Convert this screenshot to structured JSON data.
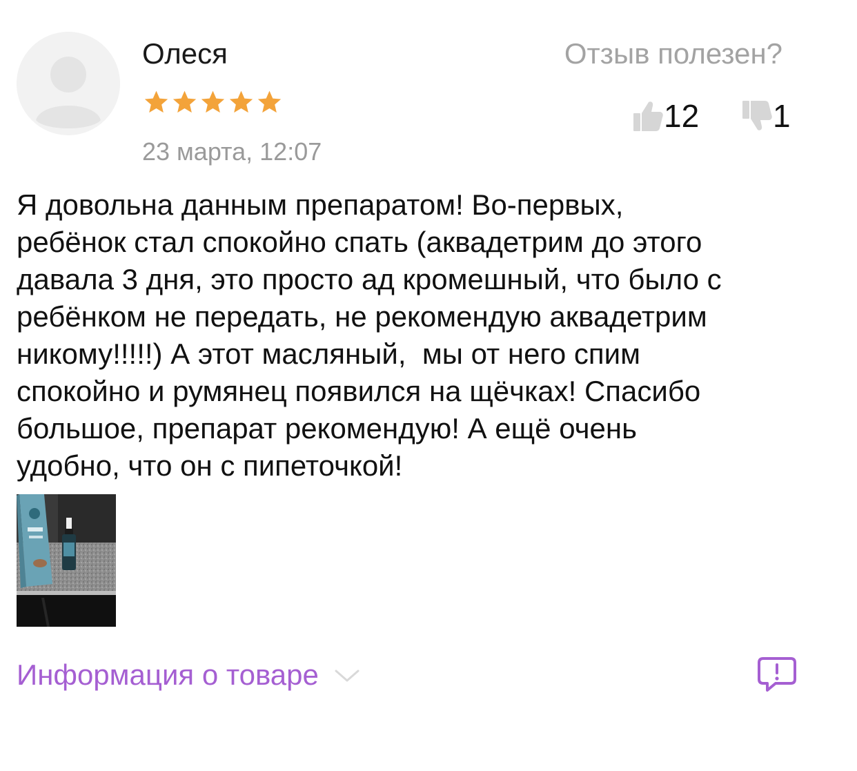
{
  "review": {
    "author": "Олеся",
    "rating": 5,
    "rating_max": 5,
    "date": "23 марта, 12:07",
    "text": "Я довольна данным препаратом! Во-первых,\nребёнок стал спокойно спать (аквадетрим до этого\nдавала 3 дня, это просто ад кромешный, что было с\nребёнком не передать, не рекомендую аквадетрим\nникому!!!!!) А этот масляный,  мы от него спим\nспокойно и румянец появился на щёчках! Спасибо\nбольшое, препарат рекомендую! А ещё очень\nудобно, что он с пипеточкой!",
    "photos_count": 1
  },
  "helpfulness": {
    "question": "Отзыв полезен?",
    "likes": "12",
    "dislikes": "1"
  },
  "footer": {
    "product_info_label": "Информация о товаре"
  },
  "colors": {
    "star": "#f3a33a",
    "accent": "#a55fd2",
    "muted_text": "#9a9a9a",
    "vote_icon": "#d6d6d6"
  },
  "icons": {
    "avatar": "user-placeholder-icon",
    "like": "thumbs-up-icon",
    "dislike": "thumbs-down-icon",
    "expand": "chevron-down-icon",
    "report": "report-message-icon"
  }
}
